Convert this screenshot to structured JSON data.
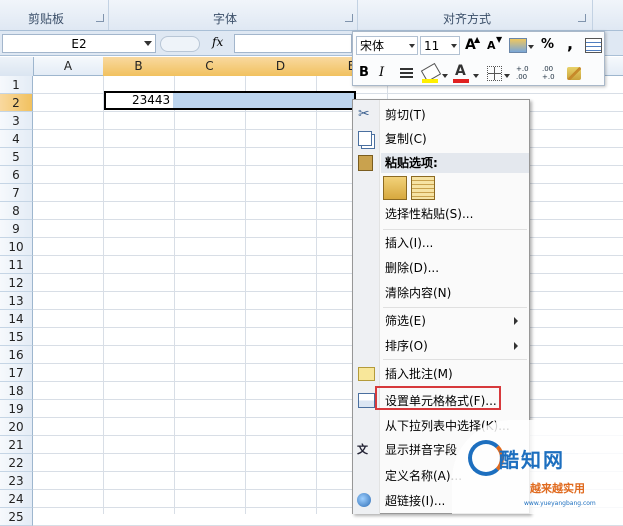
{
  "ribbon": {
    "groups": [
      "剪贴板",
      "字体",
      "对齐方式"
    ]
  },
  "formula_bar": {
    "name_box": "E2",
    "fx_label": "fx",
    "value": ""
  },
  "grid": {
    "columns": [
      "A",
      "B",
      "C",
      "D",
      "E"
    ],
    "rows": [
      "1",
      "2",
      "3",
      "4",
      "5",
      "6",
      "7",
      "8",
      "9",
      "10",
      "11",
      "12",
      "13",
      "14",
      "15",
      "16",
      "17",
      "18",
      "19",
      "20",
      "21",
      "22",
      "23",
      "24",
      "25"
    ],
    "selected_row": "2",
    "cells": {
      "B2": "23443"
    }
  },
  "mini_toolbar": {
    "font_name": "宋体",
    "font_size": "11",
    "grow_font": "A",
    "shrink_font": "A",
    "percent": "%",
    "comma": ",",
    "bold": "B",
    "italic": "I",
    "font_color": "A",
    "dec_increase": "+.0\n.00",
    "dec_decrease": ".00\n+.0"
  },
  "context_menu": {
    "items": [
      {
        "label": "剪切(T)",
        "icon": "scissors-icon"
      },
      {
        "label": "复制(C)",
        "icon": "copy-icon"
      },
      {
        "label": "粘贴选项:",
        "icon": "paste-icon"
      },
      {
        "label": "选择性粘贴(S)...",
        "icon": ""
      },
      {
        "label": "插入(I)...",
        "icon": ""
      },
      {
        "label": "删除(D)...",
        "icon": ""
      },
      {
        "label": "清除内容(N)",
        "icon": ""
      },
      {
        "label": "筛选(E)",
        "icon": ""
      },
      {
        "label": "排序(O)",
        "icon": ""
      },
      {
        "label": "插入批注(M)",
        "icon": "comment-icon"
      },
      {
        "label": "设置单元格格式(F)...",
        "icon": "format-cells-icon"
      },
      {
        "label": "从下拉列表中选择(K)...",
        "icon": ""
      },
      {
        "label": "显示拼音字段",
        "icon": "phonetic-icon"
      },
      {
        "label": "定义名称(A)...",
        "icon": ""
      },
      {
        "label": "超链接(I)...",
        "icon": "hyperlink-icon"
      }
    ]
  },
  "watermark": {
    "line1": "酷知网",
    "line2": "越来越实用",
    "line3": "www.yueyangbang.com"
  },
  "colors": {
    "selection": "#bcd4ee",
    "header_selected": "#f1c15f",
    "highlight_box": "#d7393c"
  }
}
